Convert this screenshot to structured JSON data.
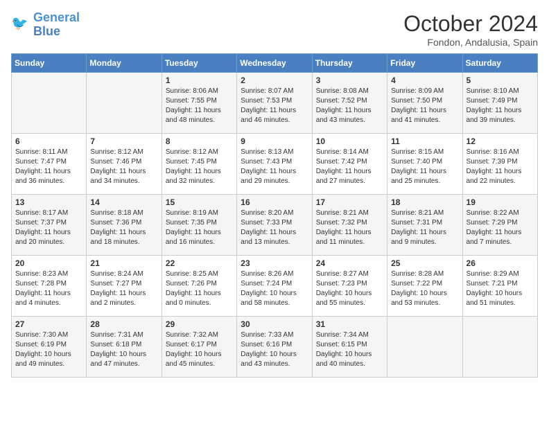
{
  "header": {
    "logo_line1": "General",
    "logo_line2": "Blue",
    "month": "October 2024",
    "location": "Fondon, Andalusia, Spain"
  },
  "days_of_week": [
    "Sunday",
    "Monday",
    "Tuesday",
    "Wednesday",
    "Thursday",
    "Friday",
    "Saturday"
  ],
  "weeks": [
    [
      {
        "day": "",
        "info": ""
      },
      {
        "day": "",
        "info": ""
      },
      {
        "day": "1",
        "info": "Sunrise: 8:06 AM\nSunset: 7:55 PM\nDaylight: 11 hours and 48 minutes."
      },
      {
        "day": "2",
        "info": "Sunrise: 8:07 AM\nSunset: 7:53 PM\nDaylight: 11 hours and 46 minutes."
      },
      {
        "day": "3",
        "info": "Sunrise: 8:08 AM\nSunset: 7:52 PM\nDaylight: 11 hours and 43 minutes."
      },
      {
        "day": "4",
        "info": "Sunrise: 8:09 AM\nSunset: 7:50 PM\nDaylight: 11 hours and 41 minutes."
      },
      {
        "day": "5",
        "info": "Sunrise: 8:10 AM\nSunset: 7:49 PM\nDaylight: 11 hours and 39 minutes."
      }
    ],
    [
      {
        "day": "6",
        "info": "Sunrise: 8:11 AM\nSunset: 7:47 PM\nDaylight: 11 hours and 36 minutes."
      },
      {
        "day": "7",
        "info": "Sunrise: 8:12 AM\nSunset: 7:46 PM\nDaylight: 11 hours and 34 minutes."
      },
      {
        "day": "8",
        "info": "Sunrise: 8:12 AM\nSunset: 7:45 PM\nDaylight: 11 hours and 32 minutes."
      },
      {
        "day": "9",
        "info": "Sunrise: 8:13 AM\nSunset: 7:43 PM\nDaylight: 11 hours and 29 minutes."
      },
      {
        "day": "10",
        "info": "Sunrise: 8:14 AM\nSunset: 7:42 PM\nDaylight: 11 hours and 27 minutes."
      },
      {
        "day": "11",
        "info": "Sunrise: 8:15 AM\nSunset: 7:40 PM\nDaylight: 11 hours and 25 minutes."
      },
      {
        "day": "12",
        "info": "Sunrise: 8:16 AM\nSunset: 7:39 PM\nDaylight: 11 hours and 22 minutes."
      }
    ],
    [
      {
        "day": "13",
        "info": "Sunrise: 8:17 AM\nSunset: 7:37 PM\nDaylight: 11 hours and 20 minutes."
      },
      {
        "day": "14",
        "info": "Sunrise: 8:18 AM\nSunset: 7:36 PM\nDaylight: 11 hours and 18 minutes."
      },
      {
        "day": "15",
        "info": "Sunrise: 8:19 AM\nSunset: 7:35 PM\nDaylight: 11 hours and 16 minutes."
      },
      {
        "day": "16",
        "info": "Sunrise: 8:20 AM\nSunset: 7:33 PM\nDaylight: 11 hours and 13 minutes."
      },
      {
        "day": "17",
        "info": "Sunrise: 8:21 AM\nSunset: 7:32 PM\nDaylight: 11 hours and 11 minutes."
      },
      {
        "day": "18",
        "info": "Sunrise: 8:21 AM\nSunset: 7:31 PM\nDaylight: 11 hours and 9 minutes."
      },
      {
        "day": "19",
        "info": "Sunrise: 8:22 AM\nSunset: 7:29 PM\nDaylight: 11 hours and 7 minutes."
      }
    ],
    [
      {
        "day": "20",
        "info": "Sunrise: 8:23 AM\nSunset: 7:28 PM\nDaylight: 11 hours and 4 minutes."
      },
      {
        "day": "21",
        "info": "Sunrise: 8:24 AM\nSunset: 7:27 PM\nDaylight: 11 hours and 2 minutes."
      },
      {
        "day": "22",
        "info": "Sunrise: 8:25 AM\nSunset: 7:26 PM\nDaylight: 11 hours and 0 minutes."
      },
      {
        "day": "23",
        "info": "Sunrise: 8:26 AM\nSunset: 7:24 PM\nDaylight: 10 hours and 58 minutes."
      },
      {
        "day": "24",
        "info": "Sunrise: 8:27 AM\nSunset: 7:23 PM\nDaylight: 10 hours and 55 minutes."
      },
      {
        "day": "25",
        "info": "Sunrise: 8:28 AM\nSunset: 7:22 PM\nDaylight: 10 hours and 53 minutes."
      },
      {
        "day": "26",
        "info": "Sunrise: 8:29 AM\nSunset: 7:21 PM\nDaylight: 10 hours and 51 minutes."
      }
    ],
    [
      {
        "day": "27",
        "info": "Sunrise: 7:30 AM\nSunset: 6:19 PM\nDaylight: 10 hours and 49 minutes."
      },
      {
        "day": "28",
        "info": "Sunrise: 7:31 AM\nSunset: 6:18 PM\nDaylight: 10 hours and 47 minutes."
      },
      {
        "day": "29",
        "info": "Sunrise: 7:32 AM\nSunset: 6:17 PM\nDaylight: 10 hours and 45 minutes."
      },
      {
        "day": "30",
        "info": "Sunrise: 7:33 AM\nSunset: 6:16 PM\nDaylight: 10 hours and 43 minutes."
      },
      {
        "day": "31",
        "info": "Sunrise: 7:34 AM\nSunset: 6:15 PM\nDaylight: 10 hours and 40 minutes."
      },
      {
        "day": "",
        "info": ""
      },
      {
        "day": "",
        "info": ""
      }
    ]
  ]
}
